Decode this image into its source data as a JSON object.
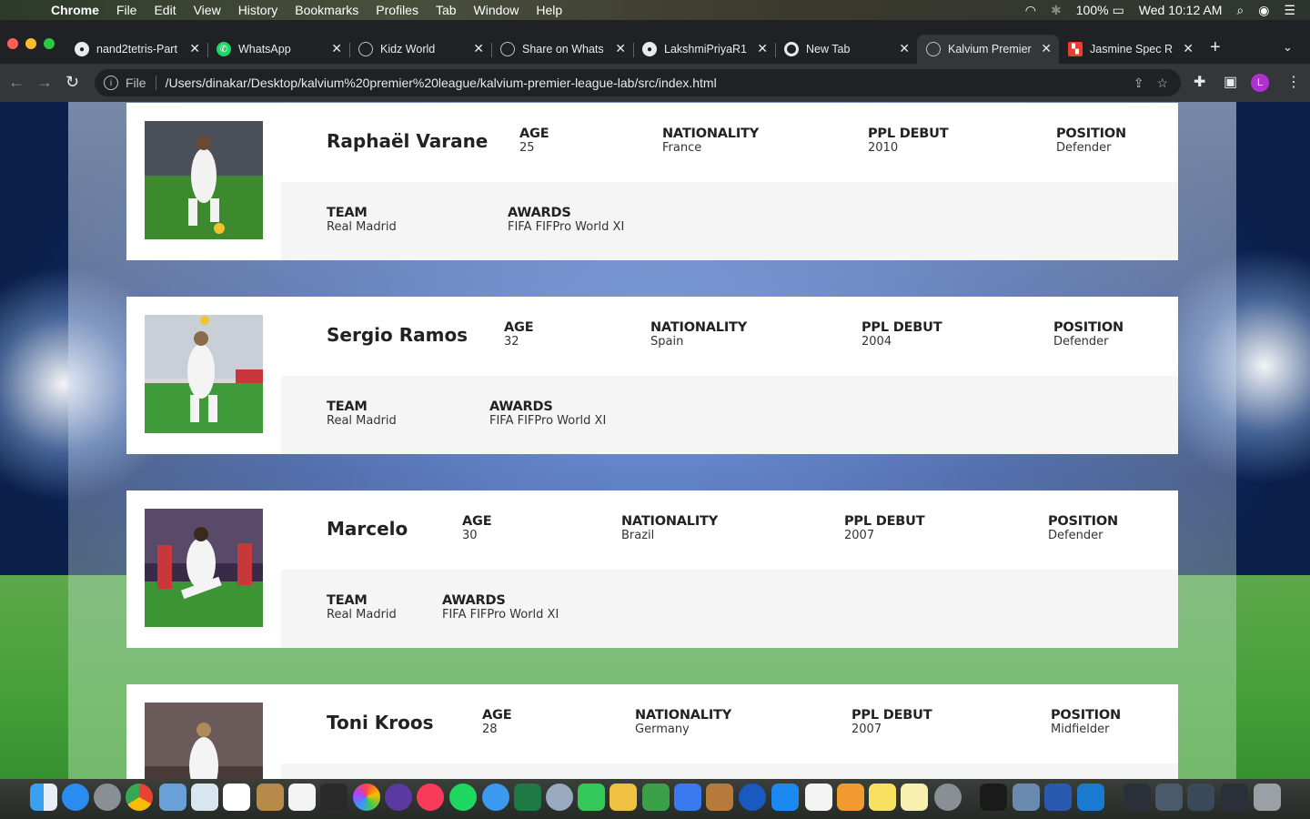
{
  "menubar": {
    "app": "Chrome",
    "items": [
      "File",
      "Edit",
      "View",
      "History",
      "Bookmarks",
      "Profiles",
      "Tab",
      "Window",
      "Help"
    ],
    "battery": "100%",
    "clock": "Wed 10:12 AM"
  },
  "tabs": [
    {
      "label": "nand2tetris-Part",
      "icon": "github-icon"
    },
    {
      "label": "WhatsApp",
      "icon": "whatsapp-icon"
    },
    {
      "label": "Kidz World",
      "icon": "globe-icon"
    },
    {
      "label": "Share on Whats",
      "icon": "globe-icon"
    },
    {
      "label": "LakshmiPriyaR1",
      "icon": "github-icon"
    },
    {
      "label": "New Tab",
      "icon": "chrome-icon"
    },
    {
      "label": "Kalvium Premier",
      "icon": "globe-icon",
      "active": true
    },
    {
      "label": "Jasmine Spec R",
      "icon": "jasmine-icon"
    }
  ],
  "omnibox": {
    "scheme": "File",
    "url": "/Users/dinakar/Desktop/kalvium%20premier%20league/kalvium-premier-league-lab/src/index.html"
  },
  "labels": {
    "age": "AGE",
    "nationality": "NATIONALITY",
    "debut": "PPL DEBUT",
    "position": "POSITION",
    "team": "TEAM",
    "awards": "AWARDS"
  },
  "players": [
    {
      "name": "Raphaël Varane",
      "age": "25",
      "nationality": "France",
      "debut": "2010",
      "position": "Defender",
      "team": "Real Madrid",
      "awards": "FIFA FIFPro World XI"
    },
    {
      "name": "Sergio Ramos",
      "age": "32",
      "nationality": "Spain",
      "debut": "2004",
      "position": "Defender",
      "team": "Real Madrid",
      "awards": "FIFA FIFPro World XI"
    },
    {
      "name": "Marcelo",
      "age": "30",
      "nationality": "Brazil",
      "debut": "2007",
      "position": "Defender",
      "team": "Real Madrid",
      "awards": "FIFA FIFPro World XI"
    },
    {
      "name": "Toni Kroos",
      "age": "28",
      "nationality": "Germany",
      "debut": "2007",
      "position": "Midfielder",
      "team": "",
      "awards": ""
    }
  ],
  "colors": {
    "chrome_dark": "#202124",
    "chrome_toolbar": "#35363a",
    "card_bg": "#ffffff",
    "card_alt_row": "#f5f5f5",
    "profile": "#b22fd1"
  }
}
